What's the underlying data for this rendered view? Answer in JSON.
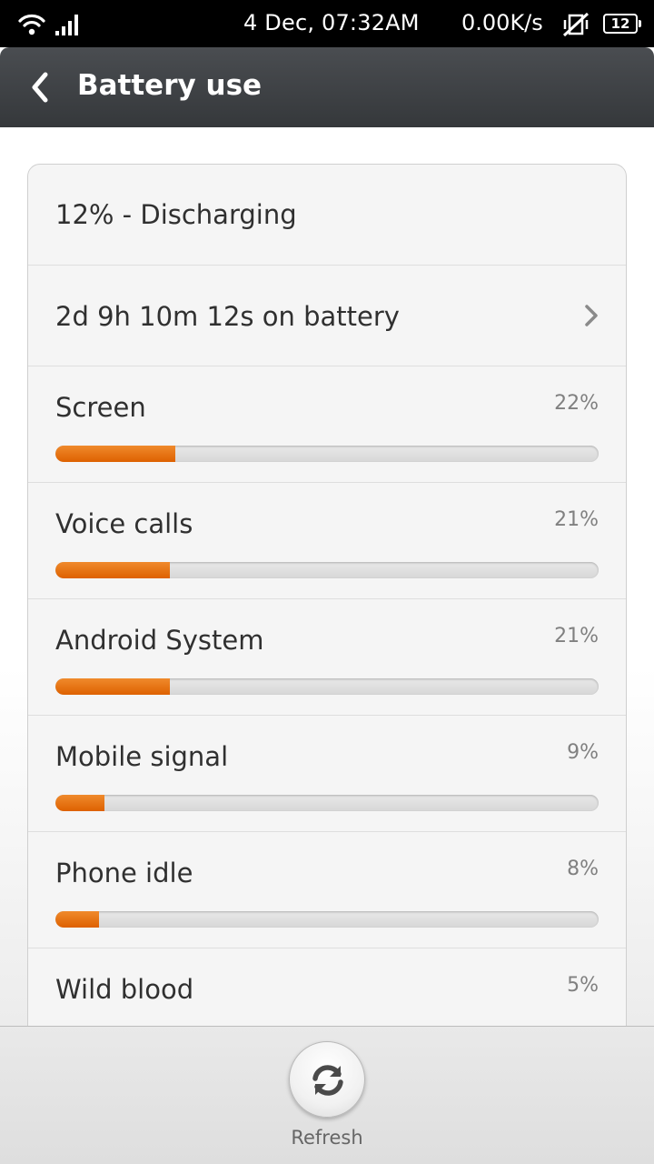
{
  "status_bar": {
    "time": "4 Dec, 07:32AM",
    "net_speed": "0.00K/s",
    "battery_level": "12",
    "icons": [
      "wifi-icon",
      "signal-icon",
      "muted-vibrate-icon",
      "battery-icon"
    ]
  },
  "header": {
    "title": "Battery use",
    "back_icon": "chevron-left-icon"
  },
  "summary": {
    "status": "12% - Discharging",
    "time_on_battery": "2d 9h 10m 12s on battery"
  },
  "usage_items": [
    {
      "label": "Screen",
      "percent_text": "22%",
      "fill_fraction": 0.22
    },
    {
      "label": "Voice calls",
      "percent_text": "21%",
      "fill_fraction": 0.21
    },
    {
      "label": "Android System",
      "percent_text": "21%",
      "fill_fraction": 0.21
    },
    {
      "label": "Mobile signal",
      "percent_text": "9%",
      "fill_fraction": 0.09
    },
    {
      "label": "Phone idle",
      "percent_text": "8%",
      "fill_fraction": 0.08
    },
    {
      "label": "Wild blood",
      "percent_text": "5%",
      "fill_fraction": 0.05
    }
  ],
  "footer": {
    "refresh_label": "Refresh",
    "refresh_icon": "refresh-icon"
  },
  "colors": {
    "accent": "#e8720f",
    "header_bg": "#3e4145",
    "status_bar_bg": "#000000"
  }
}
